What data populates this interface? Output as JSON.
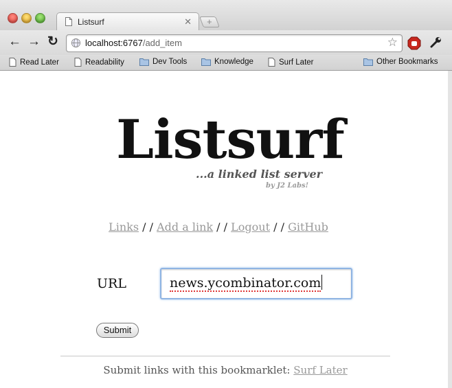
{
  "browser": {
    "tab_title": "Listsurf",
    "url_host": "localhost:6767",
    "url_path": "/add_item",
    "bookmarks": [
      {
        "label": "Read Later",
        "icon": "page-icon"
      },
      {
        "label": "Readability",
        "icon": "page-icon"
      },
      {
        "label": "Dev Tools",
        "icon": "folder-icon"
      },
      {
        "label": "Knowledge",
        "icon": "folder-icon"
      },
      {
        "label": "Surf Later",
        "icon": "page-icon"
      },
      {
        "label": "Other Bookmarks",
        "icon": "folder-icon"
      }
    ]
  },
  "page": {
    "logo": "Listsurf",
    "tagline": "...a linked list server",
    "byline": "by J2 Labs!",
    "nav": {
      "links": "Links",
      "add_link": "Add a link",
      "logout": "Logout",
      "github": "GitHub",
      "separator": "/ /"
    },
    "form": {
      "url_label": "URL",
      "url_value": "news.ycombinator.com",
      "submit_label": "Submit"
    },
    "footer": {
      "text": "Submit links with this bookmarklet:",
      "bookmarklet_link": "Surf Later"
    }
  },
  "colors": {
    "link": "#999999",
    "focus_ring": "#8fb4e3",
    "text": "#111111"
  }
}
